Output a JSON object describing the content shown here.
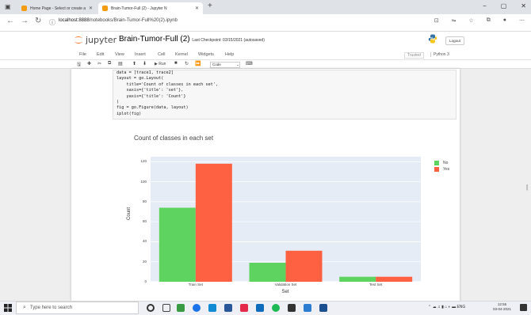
{
  "browser": {
    "tabs": [
      {
        "label": "Home Page - Select or create a"
      },
      {
        "label": "Brain-Tumor-Full (2) - Jupyter N"
      }
    ],
    "new_tab": "+",
    "url_host": "localhost:8888",
    "url_path": "/notebooks/Brain-Tumor-Full%20(2).ipynb",
    "window_controls": [
      "−",
      "▢",
      "✕"
    ]
  },
  "jupyter": {
    "logo_text": "jupyter",
    "notebook_name": "Brain-Tumor-Full (2)",
    "checkpoint": "Last Checkpoint: 03/15/2021  (autosaved)",
    "logout": "Logout",
    "menu": [
      "File",
      "Edit",
      "View",
      "Insert",
      "Cell",
      "Kernel",
      "Widgets",
      "Help"
    ],
    "trusted": "Trusted",
    "kernel": "Python 3",
    "toolbar_run": "Run",
    "cell_type": "Code"
  },
  "code_lines": [
    "data = [trace1, trace2]",
    "layout = go.Layout(",
    "    title='Count of classes in each set',",
    "    xaxis={'title': 'set'},",
    "    yaxis={'title': 'Count'}",
    ")",
    "fig = go.Figure(data, layout)",
    "iplot(fig)"
  ],
  "chart_data": {
    "type": "bar",
    "title": "Count of classes in each set",
    "xlabel": "Set",
    "ylabel": "Count",
    "categories": [
      "Train Set",
      "Validation Set",
      "Test Set"
    ],
    "series": [
      {
        "name": "No",
        "color": "#5fd35f",
        "values": [
          74,
          19,
          5
        ]
      },
      {
        "name": "Yes",
        "color": "#fe6141",
        "values": [
          118,
          31,
          5
        ]
      }
    ],
    "ylim": [
      0,
      125
    ],
    "yticks": [
      "0",
      "20",
      "40",
      "60",
      "80",
      "100",
      "120"
    ],
    "grid": true,
    "legend": "top-right"
  },
  "taskbar": {
    "search_placeholder": "Type here to search",
    "language": "ENG",
    "time": "12:55",
    "date": "03-04-2021"
  }
}
